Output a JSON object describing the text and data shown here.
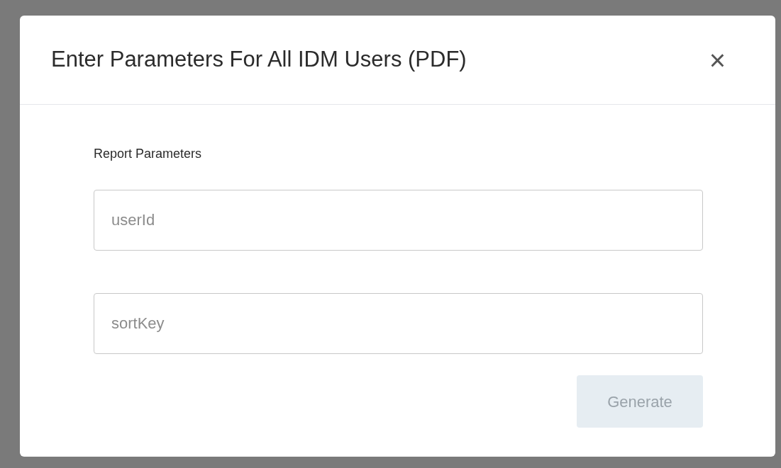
{
  "dialog": {
    "title": "Enter Parameters For All IDM Users (PDF)",
    "close": "×",
    "section_label": "Report Parameters",
    "fields": [
      {
        "placeholder": "userId"
      },
      {
        "placeholder": "sortKey"
      }
    ],
    "button": {
      "label": "Generate",
      "disabled": true
    }
  }
}
